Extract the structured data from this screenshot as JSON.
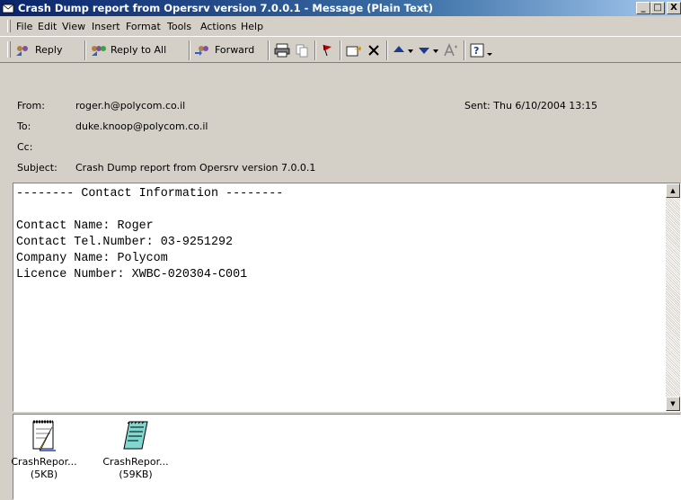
{
  "window": {
    "title": "Crash Dump report from Opersrv version 7.0.0.1 - Message (Plain Text)",
    "minimize": "_",
    "maximize": "□",
    "close": "X"
  },
  "menu": [
    "File",
    "Edit",
    "View",
    "Insert",
    "Format",
    "Tools",
    "Actions",
    "Help"
  ],
  "toolbar": {
    "reply": "Reply",
    "reply_all": "Reply to All",
    "forward": "Forward"
  },
  "header": {
    "from_label": "From:",
    "from_value": "roger.h@polycom.co.il",
    "to_label": "To:",
    "to_value": "duke.knoop@polycom.co.il",
    "cc_label": "Cc:",
    "cc_value": "",
    "subject_label": "Subject:",
    "subject_value": "Crash Dump report from Opersrv version 7.0.0.1",
    "sent_label": "Sent:",
    "sent_value": "Thu 6/10/2004 13:15"
  },
  "body": {
    "text": "-------- Contact Information --------\n\nContact Name: Roger\nContact Tel.Number: 03-9251292\nCompany Name: Polycom\nLicence Number: XWBC-020304-C001"
  },
  "attachments": [
    {
      "name": "CrashRepor...",
      "size": "(5KB)",
      "icon": "notepad-icon"
    },
    {
      "name": "CrashRepor...",
      "size": "(59KB)",
      "icon": "text-document-icon"
    }
  ],
  "colors": {
    "title_start": "#0a246a",
    "title_end": "#a6caf0",
    "chrome": "#d4d0c8"
  }
}
